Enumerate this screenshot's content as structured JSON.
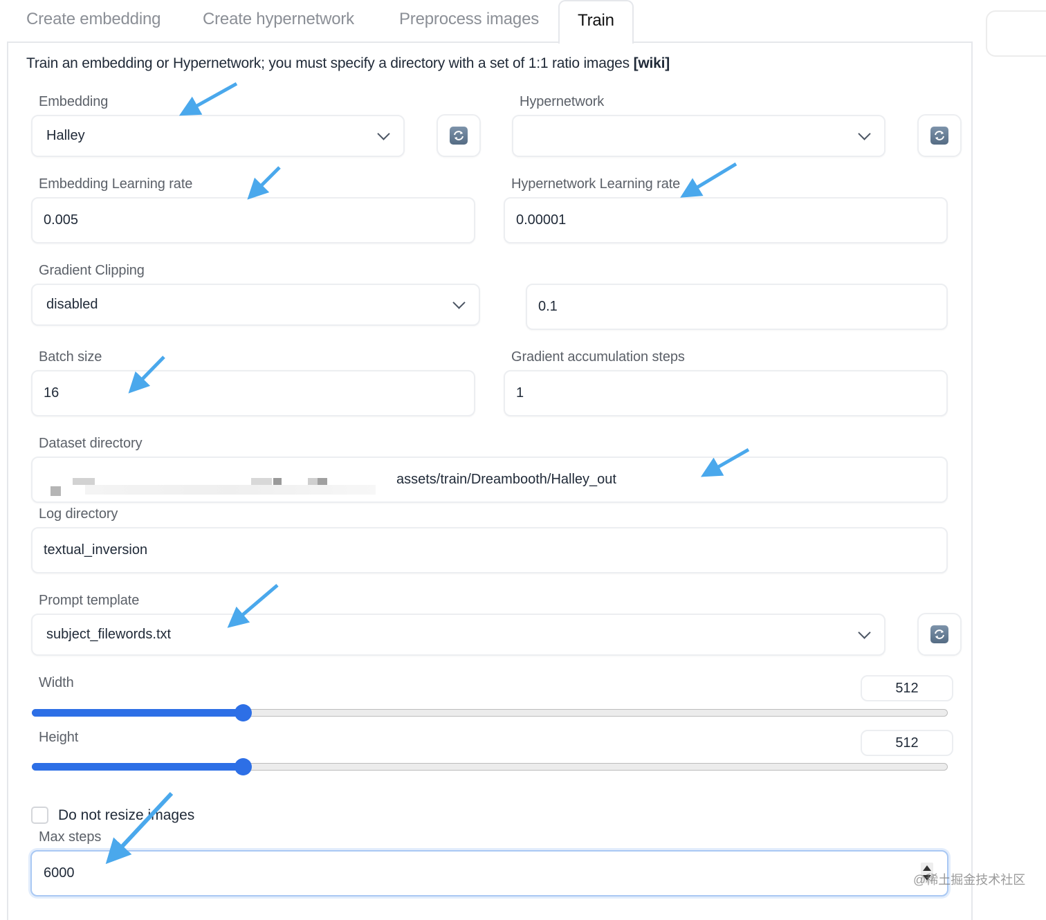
{
  "tabs": [
    {
      "label": "Create embedding",
      "active": false
    },
    {
      "label": "Create hypernetwork",
      "active": false
    },
    {
      "label": "Preprocess images",
      "active": false
    },
    {
      "label": "Train",
      "active": true
    }
  ],
  "description": {
    "text": "Train an embedding or Hypernetwork; you must specify a directory with a set of 1:1 ratio images ",
    "link": "[wiki]"
  },
  "embedding": {
    "label": "Embedding",
    "value": "Halley",
    "refresh_icon": "refresh-icon"
  },
  "hypernetwork": {
    "label": "Hypernetwork",
    "value": "",
    "refresh_icon": "refresh-icon"
  },
  "embedding_lr": {
    "label": "Embedding Learning rate",
    "value": "0.005"
  },
  "hypernetwork_lr": {
    "label": "Hypernetwork Learning rate",
    "value": "0.00001"
  },
  "gradient_clipping": {
    "label": "Gradient Clipping",
    "value": "disabled",
    "clip_value": "0.1"
  },
  "batch_size": {
    "label": "Batch size",
    "value": "16"
  },
  "grad_accum": {
    "label": "Gradient accumulation steps",
    "value": "1"
  },
  "dataset_dir": {
    "label": "Dataset directory",
    "value_visible": "assets/train/Dreambooth/Halley_out",
    "prefix_redacted": true
  },
  "log_dir": {
    "label": "Log directory",
    "value": "textual_inversion"
  },
  "prompt_template": {
    "label": "Prompt template",
    "value": "subject_filewords.txt",
    "refresh_icon": "refresh-icon"
  },
  "width": {
    "label": "Width",
    "value": "512",
    "slider_fraction": 0.23
  },
  "height": {
    "label": "Height",
    "value": "512",
    "slider_fraction": 0.23
  },
  "no_resize": {
    "label": "Do not resize images",
    "checked": false
  },
  "max_steps": {
    "label": "Max steps",
    "value": "6000"
  },
  "watermark": "@稀土掘金技术社区",
  "colors": {
    "accent": "#2d6fe6",
    "annotation_arrow": "#4aa8ec",
    "focus_border": "#a9c8f3"
  }
}
